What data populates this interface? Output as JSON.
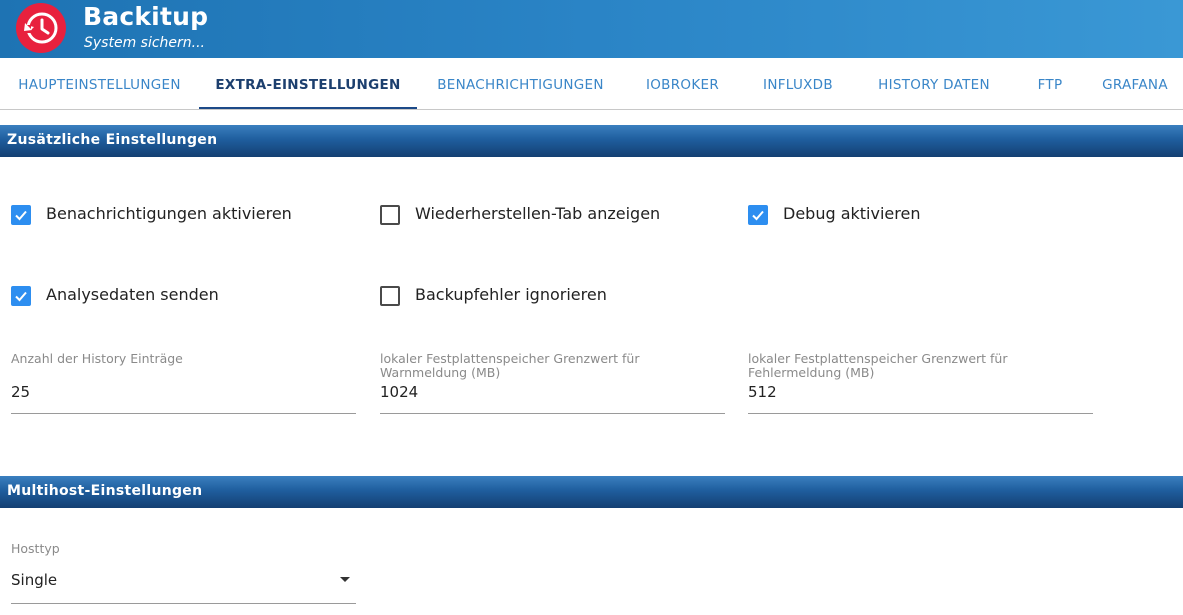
{
  "app": {
    "title": "Backitup",
    "subtitle": "System sichern..."
  },
  "tabs": [
    {
      "label": "HAUPTEINSTELLUNGEN",
      "active": false
    },
    {
      "label": "EXTRA-EINSTELLUNGEN",
      "active": true
    },
    {
      "label": "BENACHRICHTIGUNGEN",
      "active": false
    },
    {
      "label": "IOBROKER",
      "active": false
    },
    {
      "label": "INFLUXDB",
      "active": false
    },
    {
      "label": "HISTORY DATEN",
      "active": false
    },
    {
      "label": "FTP",
      "active": false
    },
    {
      "label": "GRAFANA",
      "active": false
    }
  ],
  "sections": {
    "extra": {
      "title": "Zusätzliche Einstellungen"
    },
    "multihost": {
      "title": "Multihost-Einstellungen"
    }
  },
  "checkboxes": [
    {
      "label": "Benachrichtigungen aktivieren",
      "checked": true
    },
    {
      "label": "Wiederherstellen-Tab anzeigen",
      "checked": false
    },
    {
      "label": "Debug aktivieren",
      "checked": true
    },
    {
      "label": "Analysedaten senden",
      "checked": true
    },
    {
      "label": "Backupfehler ignorieren",
      "checked": false
    }
  ],
  "fields": [
    {
      "label": "Anzahl der History Einträge",
      "value": "25"
    },
    {
      "label": "lokaler Festplattenspeicher Grenzwert für Warnmeldung (MB)",
      "value": "1024"
    },
    {
      "label": "lokaler Festplattenspeicher Grenzwert für Fehlermeldung (MB)",
      "value": "512"
    }
  ],
  "hosttype": {
    "label": "Hosttyp",
    "value": "Single"
  },
  "colors": {
    "header": "#2a84c6",
    "logo": "#e8213e",
    "checkbox_checked": "#2d8ef0",
    "tab_text": "#3a86c8",
    "tab_active": "#1c3f6e",
    "section_bar": "#1f5e9e"
  },
  "icons": {
    "logo": "clock-history-icon",
    "checkbox": "checkmark-icon",
    "dropdown": "caret-down-icon"
  }
}
